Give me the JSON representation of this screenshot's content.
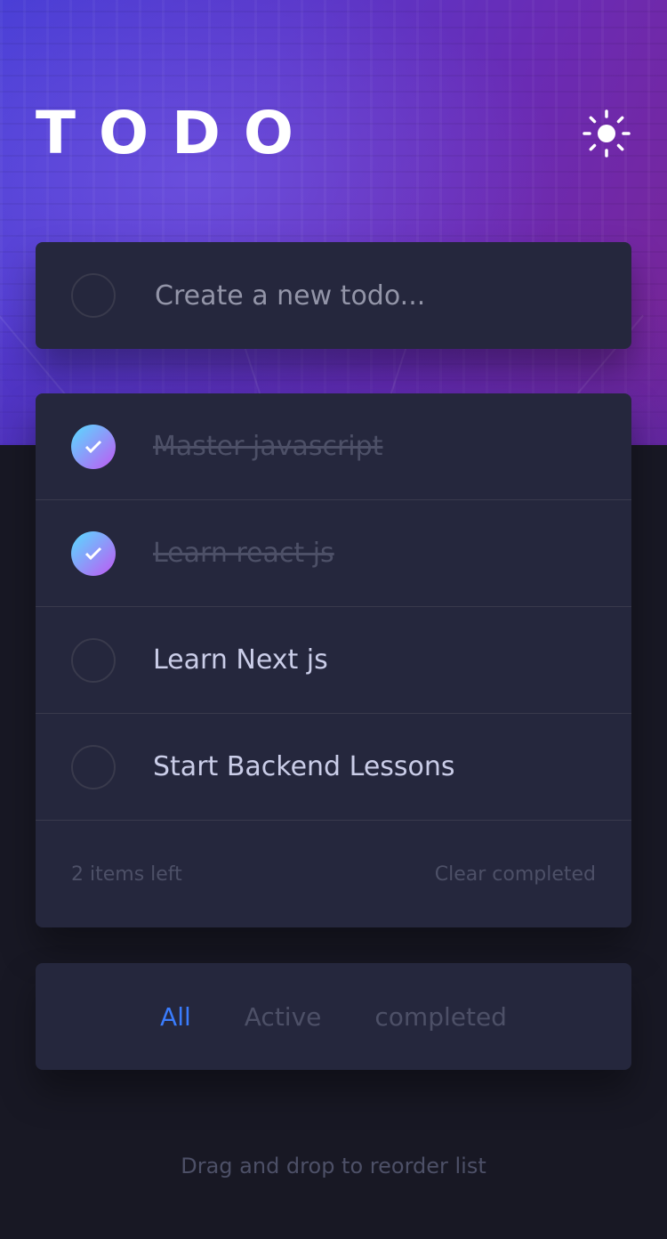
{
  "header": {
    "title": "TODO",
    "theme_icon": "sun-icon"
  },
  "new_todo": {
    "placeholder": "Create a new todo..."
  },
  "todos": [
    {
      "text": "Master javascript",
      "completed": true
    },
    {
      "text": "Learn react js",
      "completed": true
    },
    {
      "text": "Learn Next js",
      "completed": false
    },
    {
      "text": "Start Backend Lessons",
      "completed": false
    }
  ],
  "footer": {
    "items_left": "2 items left",
    "clear_label": "Clear completed"
  },
  "filters": {
    "all": "All",
    "active": "Active",
    "completed": "completed",
    "selected": "All"
  },
  "hint": "Drag and drop to reorder list",
  "colors": {
    "accent": "#3a7cfd",
    "check_gradient_start": "#57ddff",
    "check_gradient_end": "#c058f3",
    "card_bg": "#25273d",
    "page_bg": "#181824"
  }
}
